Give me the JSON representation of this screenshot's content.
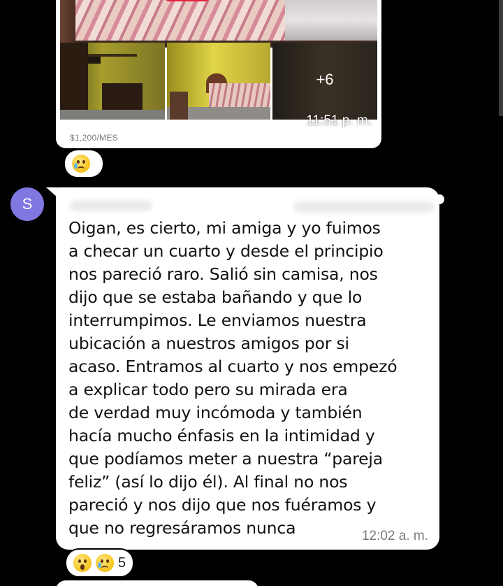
{
  "photo_message": {
    "more_photos_label": "+6",
    "time": "11:51 p. m.",
    "price_caption": "$1,200/MES",
    "reaction_emoji": "cry-face"
  },
  "sender": {
    "avatar_initial": "S",
    "avatar_color": "#8177e0"
  },
  "text_message": {
    "body": "Oigan, es cierto, mi amiga y yo fuimos\na checar un cuarto y desde el principio\nnos pareció raro. Salió sin camisa, nos\ndijo que se estaba bañando y que lo\ninterrumpimos. Le enviamos nuestra\nubicación a nuestros amigos por si\nacaso. Entramos al cuarto y nos empezó\na explicar todo pero su mirada era\nde verdad muy incómoda y también\nhacía mucho énfasis en la intimidad y\nque podíamos meter a nuestra “pareja\nfeliz” (así lo dijo él). Al final no nos\npareció y nos dijo que nos fuéramos y\nque no regresáramos nunca",
    "time": "12:02 a. m.",
    "reactions": [
      "surprised-face",
      "cry-face"
    ],
    "reaction_count": "5"
  },
  "colors": {
    "background": "#000000",
    "bubble": "#ffffff",
    "text": "#111111",
    "timestamp": "#7a7a7a"
  }
}
